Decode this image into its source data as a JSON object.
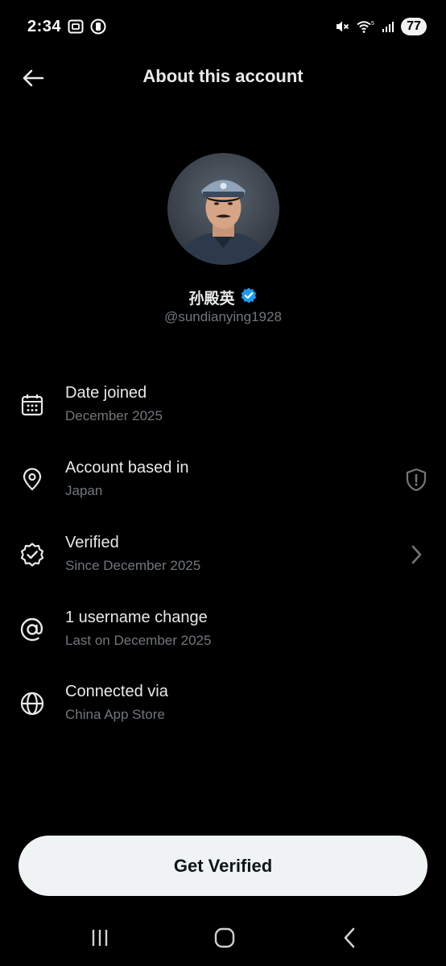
{
  "status_bar": {
    "time": "2:34",
    "battery": "77",
    "network": "5"
  },
  "header": {
    "title": "About this account"
  },
  "profile": {
    "display_name": "孙殿英",
    "handle": "@sundianying1928",
    "verified": true
  },
  "info_rows": [
    {
      "icon": "calendar-icon",
      "title": "Date joined",
      "subtitle": "December 2025"
    },
    {
      "icon": "location-pin-icon",
      "title": "Account based in",
      "subtitle": "Japan"
    },
    {
      "icon": "verified-badge-icon",
      "title": "Verified",
      "subtitle": "Since December 2025"
    },
    {
      "icon": "at-sign-icon",
      "title": "1 username change",
      "subtitle": "Last on December 2025"
    },
    {
      "icon": "globe-icon",
      "title": "Connected via",
      "subtitle": "China App Store"
    }
  ],
  "cta": {
    "label": "Get Verified"
  },
  "colors": {
    "background": "#000000",
    "text_primary": "#e7e9ea",
    "text_secondary": "#71767b",
    "verified_blue": "#1d9bf0",
    "button_bg": "#eff3f4"
  }
}
